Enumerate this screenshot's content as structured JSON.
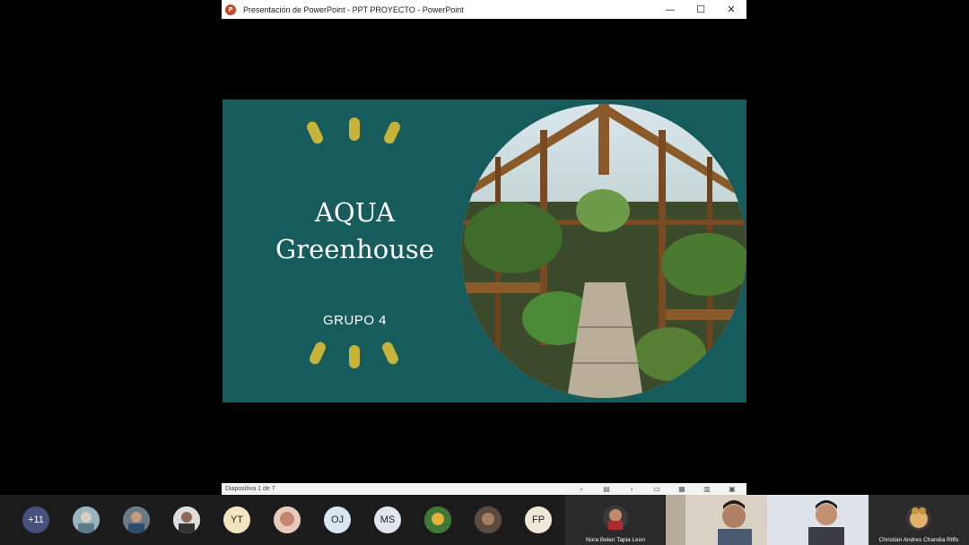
{
  "window": {
    "title": "Presentación de PowerPoint  -  PPT PROYECTO  -  PowerPoint",
    "app_icon": "powerpoint-icon",
    "controls": {
      "minimize": "—",
      "maximize": "☐",
      "close": "✕"
    }
  },
  "slide": {
    "title_line1": "AQUA",
    "title_line2": "Greenhouse",
    "subtitle": "GRUPO 4",
    "accent_color": "#c6b43a",
    "background_color": "#175c5d"
  },
  "statusbar": {
    "slide_counter": "Diapositiva 1 de 7",
    "icons": [
      "prev-slide-icon",
      "slide-menu-icon",
      "next-slide-icon",
      "normal-view-icon",
      "slide-sorter-icon",
      "reading-view-icon",
      "slideshow-icon"
    ]
  },
  "participants": {
    "more_count": "+11",
    "avatars": [
      {
        "kind": "picture",
        "icon": "profile-photo"
      },
      {
        "kind": "picture",
        "icon": "profile-photo"
      },
      {
        "kind": "picture",
        "icon": "profile-photo"
      },
      {
        "kind": "initials",
        "text": "YT"
      },
      {
        "kind": "picture",
        "icon": "profile-photo"
      },
      {
        "kind": "initials",
        "text": "OJ"
      },
      {
        "kind": "initials",
        "text": "MS"
      },
      {
        "kind": "picture",
        "icon": "profile-photo"
      },
      {
        "kind": "picture",
        "icon": "profile-photo"
      },
      {
        "kind": "initials",
        "text": "FP"
      }
    ],
    "tiles": [
      {
        "name": "Nora Belen Tapia Leon"
      },
      {
        "name": ""
      },
      {
        "name": ""
      },
      {
        "name": "Christian Andres Chandia Riffo"
      }
    ]
  }
}
